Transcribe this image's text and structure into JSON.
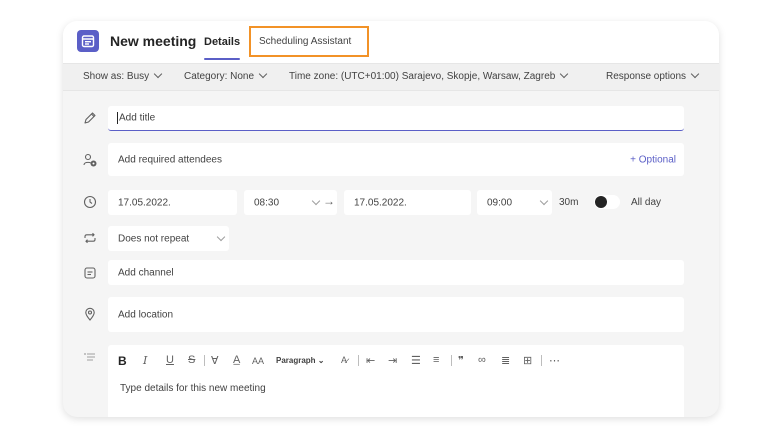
{
  "header": {
    "title": "New meeting",
    "tabs": [
      {
        "label": "Details",
        "selected": true
      },
      {
        "label": "Scheduling Assistant",
        "selected": false,
        "highlighted": true
      }
    ]
  },
  "options_bar": {
    "show_as": "Show as: Busy",
    "category": "Category: None",
    "time_zone": "Time zone: (UTC+01:00) Sarajevo, Skopje, Warsaw, Zagreb",
    "response_options": "Response options"
  },
  "form": {
    "title_placeholder": "Add title",
    "attendees_placeholder": "Add required attendees",
    "optional_link": "+ Optional",
    "start_date": "17.05.2022.",
    "start_time": "08:30",
    "end_date": "17.05.2022.",
    "end_time": "09:00",
    "duration": "30m",
    "all_day_label": "All day",
    "all_day_on": false,
    "repeat": "Does not repeat",
    "channel_placeholder": "Add channel",
    "location_placeholder": "Add location"
  },
  "editor": {
    "paragraph_style": "Paragraph",
    "body_placeholder": "Type details for this new meeting"
  },
  "colors": {
    "accent": "#5b5fc7",
    "highlight_border": "#f29227"
  }
}
